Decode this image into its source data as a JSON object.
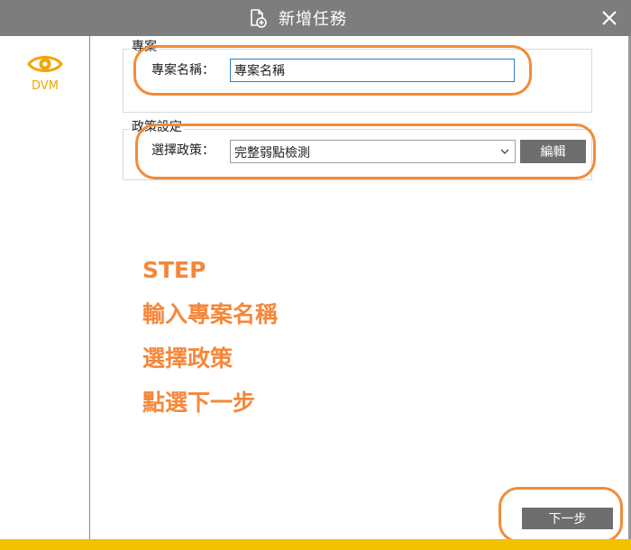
{
  "window": {
    "title": "新增任務",
    "title_icon": "document-add-icon",
    "close_icon": "close-icon"
  },
  "sidebar": {
    "items": [
      {
        "label": "DVM",
        "icon": "eye-icon",
        "color": "#f0a500"
      }
    ]
  },
  "project_group": {
    "legend": "專案",
    "name_label": "專案名稱：",
    "name_value": "專案名稱"
  },
  "policy_group": {
    "legend": "政策設定",
    "select_label": "選擇政策：",
    "selected_value": "完整弱點檢測",
    "edit_label": "編輯"
  },
  "instructions": {
    "lines": [
      "STEP",
      "輸入專案名稱",
      "選擇政策",
      "點選下一步"
    ],
    "color": "#f5873a"
  },
  "footer": {
    "next_label": "下一步",
    "accent_color": "#f2c200"
  },
  "colors": {
    "titlebar": "#7d7d7d",
    "highlight": "#f28c38",
    "button": "#6e6e6e"
  }
}
